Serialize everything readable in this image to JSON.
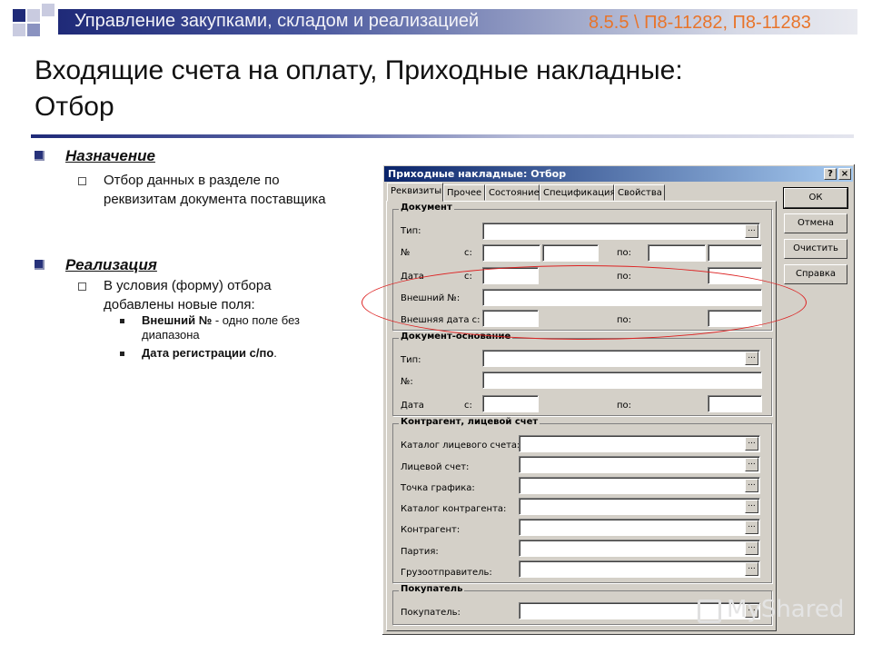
{
  "header": {
    "band_title": "Управление закупками, складом и реализацией",
    "ref": "8.5.5 \\ П8-11282, П8-11283",
    "slide_title": "Входящие счета на оплату, Приходные накладные: Отбор"
  },
  "bullets": {
    "purpose": {
      "title": "Назначение",
      "text": "Отбор данных в разделе по реквизитам документа поставщика"
    },
    "implementation": {
      "title": "Реализация",
      "text": "В условия (форму) отбора добавлены новые поля:",
      "items": [
        {
          "bold": "Внешний №",
          "rest": " - одно поле без диапазона"
        },
        {
          "bold": "Дата регистрации с/по",
          "rest": "."
        }
      ]
    }
  },
  "dialog": {
    "title": "Приходные накладные: Отбор",
    "help_glyph": "?",
    "close_glyph": "×",
    "ellipsis": "...",
    "tabs": [
      "Реквизиты",
      "Прочее",
      "Состояние",
      "Спецификация",
      "Свойства"
    ],
    "buttons": {
      "ok": "ОК",
      "cancel": "Отмена",
      "clear": "Очистить",
      "help": "Справка"
    },
    "document": {
      "title": "Документ",
      "type": "Тип:",
      "number": "№",
      "date": "Дата",
      "from": "с:",
      "to": "по:",
      "external_no": "Внешний №:",
      "external_date_from": "Внешняя дата с:"
    },
    "basis": {
      "title": "Документ-основание",
      "type": "Тип:",
      "number": "№:",
      "date": "Дата",
      "from": "с:",
      "to": "по:"
    },
    "contractor": {
      "title": "Контрагент, лицевой счет",
      "fields": [
        "Каталог лицевого счета:",
        "Лицевой счет:",
        "Точка графика:",
        "Каталог контрагента:",
        "Контрагент:",
        "Партия:",
        "Грузоотправитель:"
      ]
    },
    "buyer": {
      "title": "Покупатель",
      "label": "Покупатель:"
    }
  },
  "watermark": "MyShared",
  "colors": {
    "accent_orange": "#e8742a",
    "band_dark": "#1f2a78",
    "annotation_red": "#d22222",
    "dialog_face": "#d4d0c8"
  }
}
